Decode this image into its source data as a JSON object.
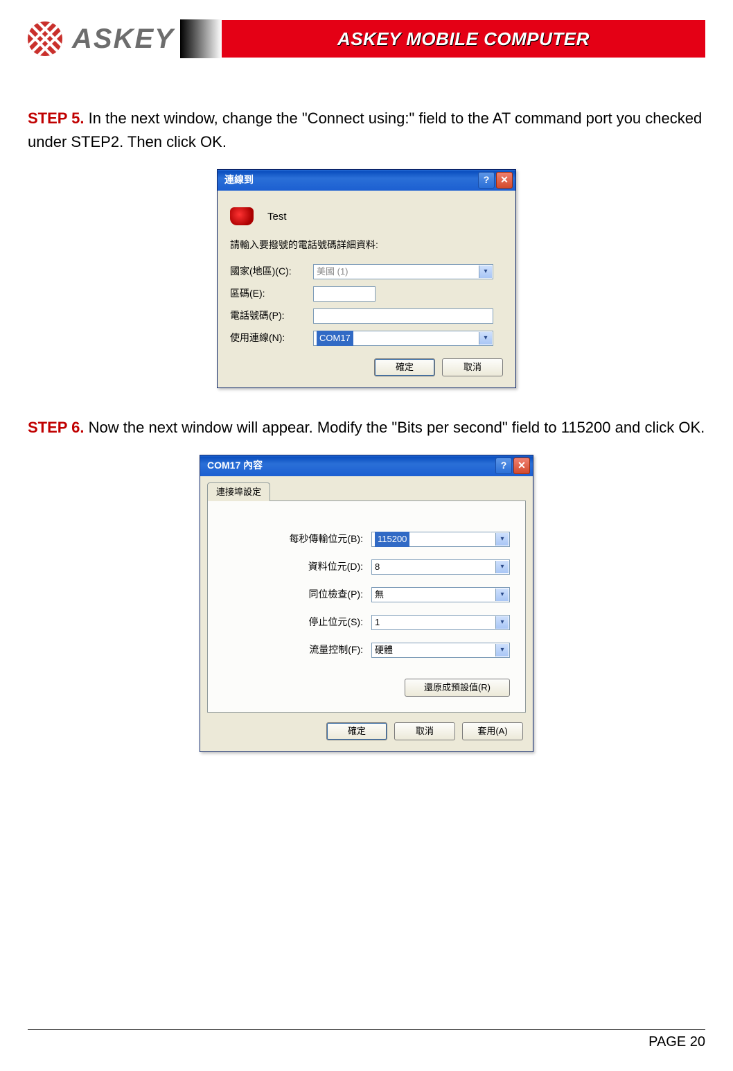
{
  "header": {
    "brand": "ASKEY",
    "banner": "ASKEY MOBILE COMPUTER"
  },
  "step5": {
    "label": "STEP 5.",
    "text": "In the next window, change the \"Connect using:\" field to the AT command port you checked under STEP2. Then click OK."
  },
  "dialog1": {
    "title": "連線到",
    "connection_name": "Test",
    "instruction": "請輸入要撥號的電話號碼詳細資料:",
    "fields": {
      "country": {
        "label": "國家(地區)(C):",
        "value": "美國 (1)"
      },
      "area": {
        "label": "區碼(E):",
        "value": ""
      },
      "phone": {
        "label": "電話號碼(P):",
        "value": ""
      },
      "connect": {
        "label": "使用連線(N):",
        "value": "COM17"
      }
    },
    "buttons": {
      "ok": "確定",
      "cancel": "取消"
    }
  },
  "step6": {
    "label": "STEP 6.",
    "text": "Now the next window will appear. Modify the \"Bits per second\" field to 115200 and click OK."
  },
  "dialog2": {
    "title": "COM17 內容",
    "tab": "連接埠設定",
    "fields": {
      "bps": {
        "label": "每秒傳輸位元(B):",
        "value": "115200"
      },
      "data": {
        "label": "資料位元(D):",
        "value": "8"
      },
      "parity": {
        "label": "同位檢查(P):",
        "value": "無"
      },
      "stop": {
        "label": "停止位元(S):",
        "value": "1"
      },
      "flow": {
        "label": "流量控制(F):",
        "value": "硬體"
      }
    },
    "restore": "還原成預設值(R)",
    "buttons": {
      "ok": "確定",
      "cancel": "取消",
      "apply": "套用(A)"
    }
  },
  "footer": {
    "page": "PAGE 20"
  }
}
